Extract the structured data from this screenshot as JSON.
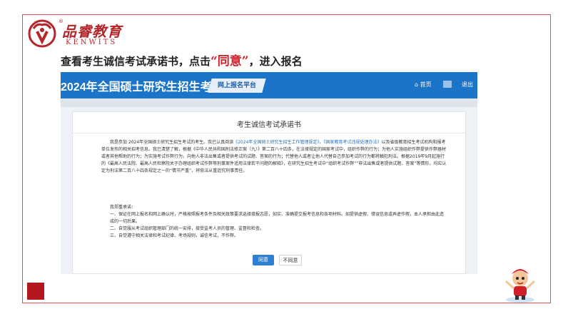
{
  "brand": {
    "name_cn": "品睿教育",
    "name_en": "KENWITS",
    "reg_mark": "®",
    "color": "#b4262a"
  },
  "instruction": {
    "before": "查看考生诚信考试承诺书，点击",
    "quote": "“同意”",
    "after": "，进入报名"
  },
  "screenshot": {
    "site_title": "2024年全国硕士研究生招生考试",
    "platform_tag": "网上报名平台",
    "nav": {
      "home": "首页",
      "exit": "退出"
    },
    "accent_color": "#1b74c7",
    "pledge": {
      "title": "考生诚信考试承诺书",
      "p1_a": "我是参加 2024年全国硕士研究生招生考试的考生。我已认真阅读",
      "p1_link1": "《2024年全国硕士研究生招生工作管理规定》",
      "p1_sep": "、",
      "p1_link2": "《国家教育考试违规处理办法》",
      "p1_b": "以及省级教育招生考试机构和报考单位发布的相关招考信息。我已清楚了解，根据《中华人民共和国刑法修正案（九）》第二百八十四条，在法律规定的国家考试中，组织作弊的行为；为他人实施组织作弊提供作弊器材或者其他帮助的行为；为实施考试作弊行为，向他人非法出售或者提供考试的试题、答案的行为；代替他人或者让他人代替自己参加考试的行为都将触犯刑法。根据2019年9月起施行的《最高人民法院、最高人民检察院关于办理组织考试作弊等刑事案件适用法律若干问题的解释》，在研究生招生考试中“组织考试作弊”“非法出售或者提供试题、答案”等情形，均应认定为刑法第二百八十四条规定之一的“情节严重”，将依法从重追究刑事责任。",
      "p2_intro": "我郑重承诺：",
      "p2_items": [
        "一、保证在网上报名和网上确认时，严格按照报考条件及相关政策要求选择填报志愿，如实、准确提交报考信息和各项材料。如提供虚假、错误信息或弄虚作假，本人承担由此造成的一切后果。",
        "二、自觉服从考试组织管理部门的统一安排，接受监考人员的管理、监督和检查。",
        "三、自觉遵守相关法律和考试纪律、考场规则，诚信考试，不作弊。"
      ],
      "agree_label": "同意",
      "disagree_label": "不同意"
    }
  }
}
